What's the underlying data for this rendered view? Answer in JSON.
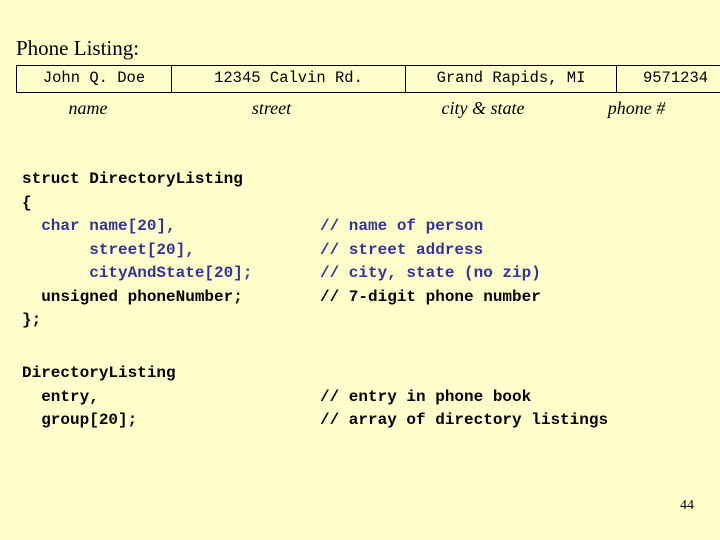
{
  "slide": {
    "background_color": "#ffffcc",
    "title": "Phone Listing:",
    "page_number": "44"
  },
  "listing_table": {
    "border_color": "#000000",
    "row": {
      "name": "John Q. Doe",
      "street": "12345 Calvin Rd.",
      "city_state": "Grand Rapids, MI",
      "phone": "9571234"
    },
    "captions": {
      "name": "name",
      "street": "street",
      "city_state": "city & state",
      "phone": "phone #"
    }
  },
  "code_struct": {
    "accent_color": "#333399",
    "lines": [
      {
        "code": "struct DirectoryListing",
        "code_color": "black",
        "comment": "",
        "comment_color": "black"
      },
      {
        "code": "{",
        "code_color": "black",
        "comment": "",
        "comment_color": "black"
      },
      {
        "code": "  char name[20],",
        "code_color": "blue",
        "comment": "// name of person",
        "comment_color": "blue"
      },
      {
        "code": "       street[20],",
        "code_color": "blue",
        "comment": "// street address",
        "comment_color": "blue"
      },
      {
        "code": "       cityAndState[20];",
        "code_color": "blue",
        "comment": "// city, state (no zip)",
        "comment_color": "blue"
      },
      {
        "code": "  unsigned phoneNumber;",
        "code_color": "black",
        "comment": "// 7-digit phone number",
        "comment_color": "black"
      },
      {
        "code": "};",
        "code_color": "black",
        "comment": "",
        "comment_color": "black"
      }
    ]
  },
  "code_decl": {
    "lines": [
      {
        "code": "DirectoryListing",
        "code_color": "black",
        "comment": "",
        "comment_color": "black"
      },
      {
        "code": "  entry,",
        "code_color": "black",
        "comment": "// entry in phone book",
        "comment_color": "black"
      },
      {
        "code": "  group[20];",
        "code_color": "black",
        "comment": "// array of directory listings",
        "comment_color": "black"
      }
    ]
  }
}
